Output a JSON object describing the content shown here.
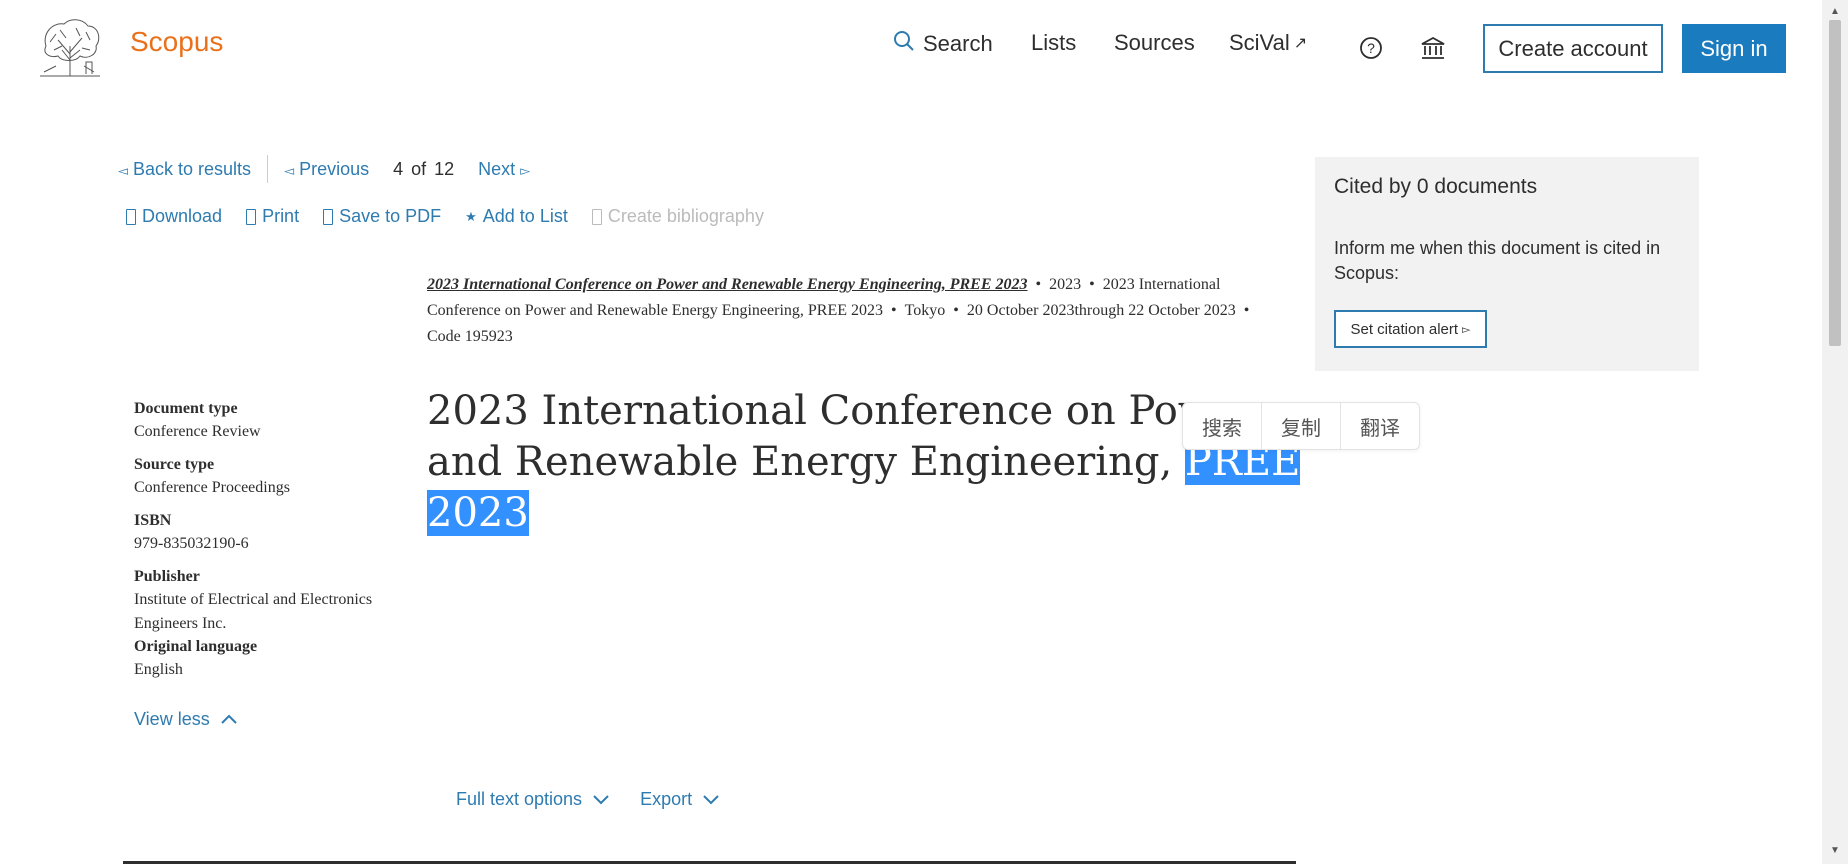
{
  "header": {
    "brand": "Scopus",
    "nav": {
      "search": "Search",
      "lists": "Lists",
      "sources": "Sources",
      "scival": "SciVal"
    },
    "create_account": "Create account",
    "sign_in": "Sign in"
  },
  "pager": {
    "back": "Back to results",
    "previous": "Previous",
    "current": "4",
    "of": "of",
    "total": "12",
    "next": "Next"
  },
  "actions": {
    "download": "Download",
    "print": "Print",
    "save_pdf": "Save to PDF",
    "add_list": "Add to List",
    "create_bibliography": "Create bibliography"
  },
  "source_info": {
    "title": "2023 International Conference on Power and Renewable Energy Engineering, PREE 2023",
    "year": "2023",
    "conference": "2023 International Conference on Power and Renewable Energy Engineering, PREE 2023",
    "location": "Tokyo",
    "dates": "20 October 2023through 22 October 2023",
    "code": "Code 195923"
  },
  "document": {
    "title_main": "2023 International Conference on Power and Renewable Energy Engineering, ",
    "title_highlight": "PREE 2023"
  },
  "context_menu": {
    "search": "搜索",
    "copy": "复制",
    "translate": "翻译"
  },
  "metadata": {
    "doc_type_label": "Document type",
    "doc_type": "Conference Review",
    "source_type_label": "Source type",
    "source_type": "Conference Proceedings",
    "isbn_label": "ISBN",
    "isbn": "979-835032190-6",
    "publisher_label": "Publisher",
    "publisher": "Institute of Electrical and Electronics Engineers Inc.",
    "language_label": "Original language",
    "language": "English",
    "view_less": "View less"
  },
  "cited": {
    "title": "Cited by 0 documents",
    "text": "Inform me when this document is cited in Scopus:",
    "alert_button": "Set citation alert"
  },
  "options": {
    "full_text": "Full text options",
    "export": "Export"
  },
  "colors": {
    "brand": "#e9711c",
    "link": "#2e7bb0",
    "primary_button": "#1a7bbf",
    "highlight": "#3390ff"
  }
}
